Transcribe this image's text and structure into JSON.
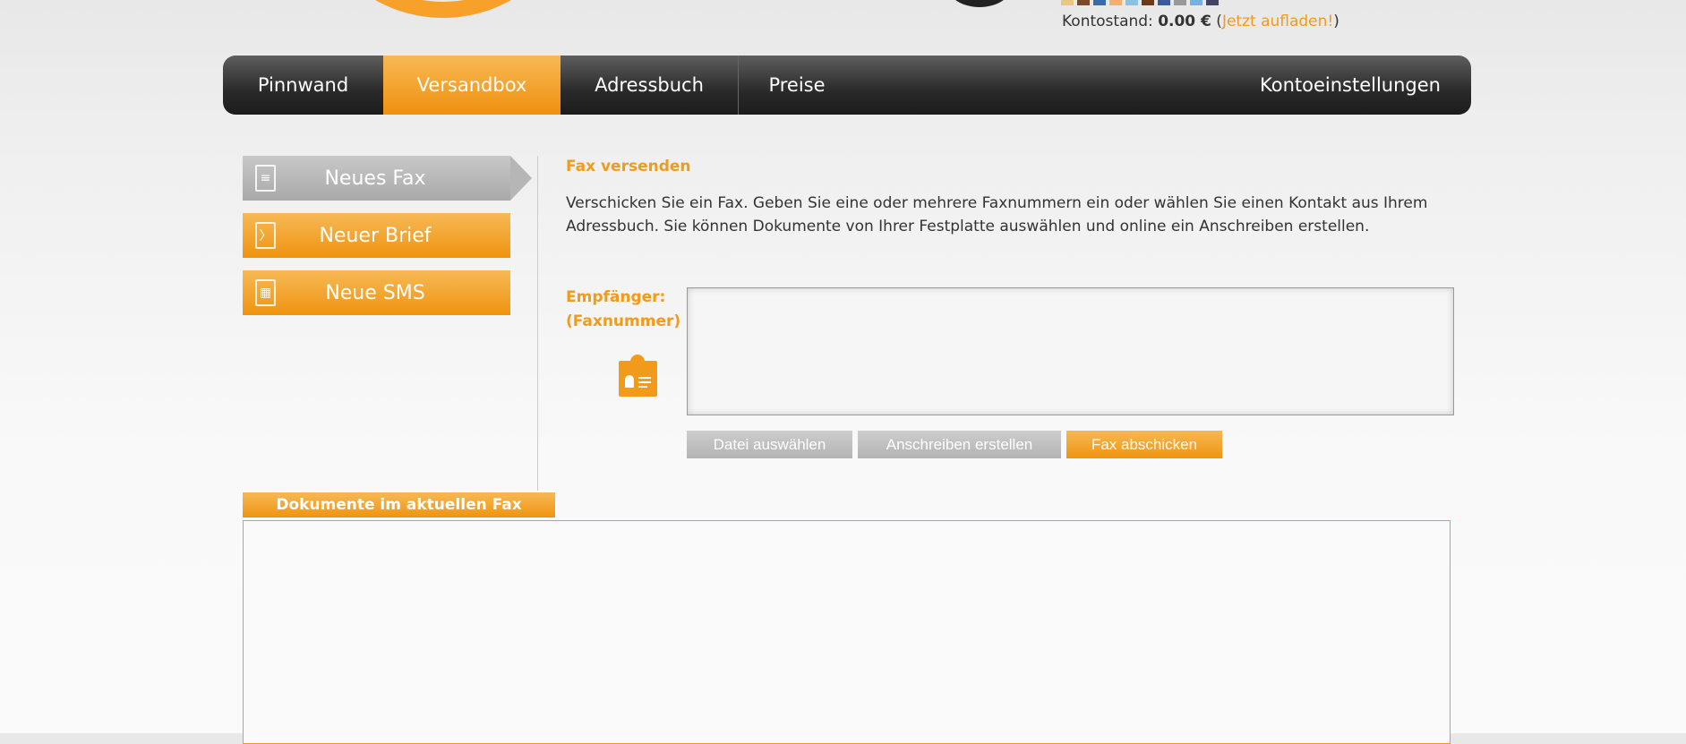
{
  "header": {
    "balance_label": "Kontostand:",
    "balance_value": "0.00 €",
    "recharge_link": "Jetzt aufladen!",
    "stripe_colors": [
      "#e8c87a",
      "#7a4a2a",
      "#3d6aa8",
      "#f0b070",
      "#8ac0e0",
      "#6a3a1a",
      "#3a5a9a",
      "#999999",
      "#7ab0e0",
      "#444466"
    ]
  },
  "nav": {
    "tabs": [
      {
        "label": "Pinnwand"
      },
      {
        "label": "Versandbox",
        "active": true
      },
      {
        "label": "Adressbuch"
      },
      {
        "label": "Preise"
      },
      {
        "label": "Kontoeinstellungen"
      }
    ]
  },
  "sidebar": {
    "items": [
      {
        "label": "Neues Fax",
        "icon": "fax-document-icon",
        "active": true
      },
      {
        "label": "Neuer Brief",
        "icon": "letter-icon"
      },
      {
        "label": "Neue SMS",
        "icon": "phone-icon"
      }
    ]
  },
  "main": {
    "title": "Fax versenden",
    "intro": "Verschicken Sie ein Fax. Geben Sie eine oder mehrere Faxnummern ein oder wählen Sie einen Kontakt aus Ihrem Adressbuch. Sie können Dokumente von Ihrer Festplatte auswählen und online ein Anschreiben erstellen.",
    "recipient_label_1": "Empfänger:",
    "recipient_label_2": "(Faxnummer)",
    "recipient_value": "",
    "buttons": {
      "choose_file": "Datei auswählen",
      "create_letter": "Anschreiben erstellen",
      "send_fax": "Fax abschicken"
    },
    "documents_title": "Dokumente im aktuellen Fax"
  },
  "colors": {
    "accent": "#f29a1a",
    "nav_dark": "#2a2a2a"
  }
}
